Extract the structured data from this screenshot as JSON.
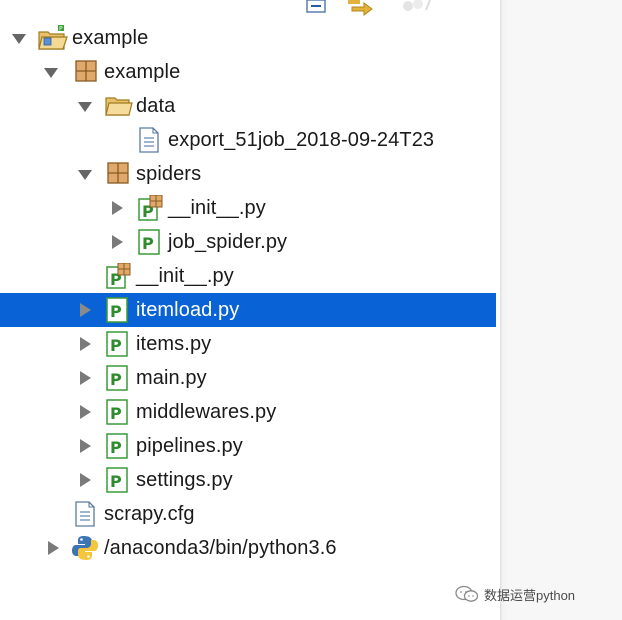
{
  "toolbar": {
    "icons": [
      "collapse-all-icon",
      "link-with-editor-icon",
      "view-menu-icon"
    ]
  },
  "tree": {
    "items": [
      {
        "label": "example",
        "icon": "project-folder-icon",
        "expanded": true
      },
      {
        "label": "example",
        "icon": "package-icon",
        "expanded": true
      },
      {
        "label": "data",
        "icon": "folder-icon",
        "expanded": true
      },
      {
        "label": "export_51job_2018-09-24T23",
        "icon": "file-icon"
      },
      {
        "label": "spiders",
        "icon": "package-icon",
        "expanded": true
      },
      {
        "label": "__init__.py",
        "icon": "python-package-module-icon",
        "expanded": false
      },
      {
        "label": "job_spider.py",
        "icon": "python-module-icon",
        "expanded": false
      },
      {
        "label": "__init__.py",
        "icon": "python-package-module-icon"
      },
      {
        "label": "itemload.py",
        "icon": "python-module-icon",
        "expanded": false,
        "selected": true
      },
      {
        "label": "items.py",
        "icon": "python-module-icon",
        "expanded": false
      },
      {
        "label": "main.py",
        "icon": "python-module-icon",
        "expanded": false
      },
      {
        "label": "middlewares.py",
        "icon": "python-module-icon",
        "expanded": false
      },
      {
        "label": "pipelines.py",
        "icon": "python-module-icon",
        "expanded": false
      },
      {
        "label": "settings.py",
        "icon": "python-module-icon",
        "expanded": false
      },
      {
        "label": "scrapy.cfg",
        "icon": "file-icon"
      },
      {
        "label": "/anaconda3/bin/python3.6",
        "icon": "python-interpreter-icon",
        "expanded": false
      }
    ]
  },
  "watermark": {
    "text": "数据运营python",
    "icon": "wechat-icon"
  },
  "colors": {
    "selection": "#0a63d6",
    "python_green": "#3a9a3a",
    "folder": "#e9c46a"
  }
}
